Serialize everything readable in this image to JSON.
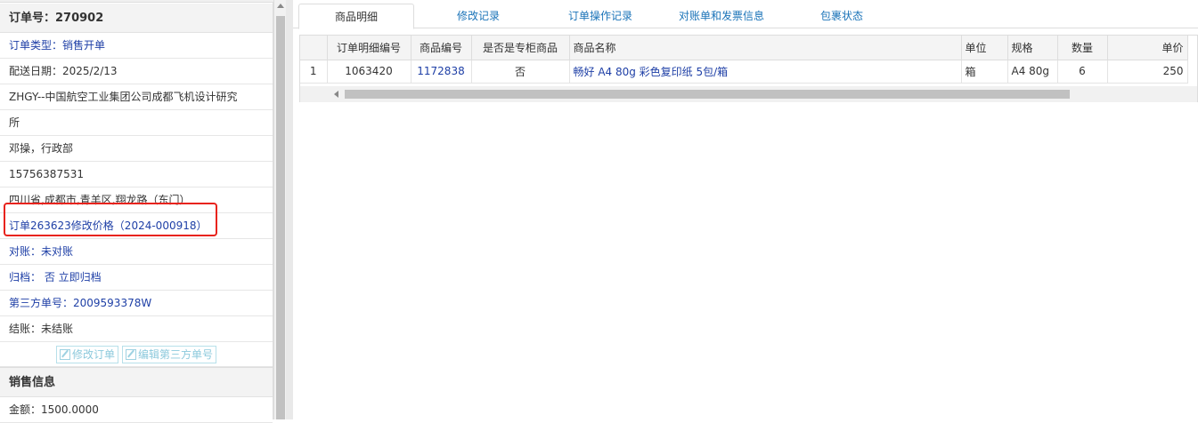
{
  "order_panel": {
    "title": "订单号：270902",
    "rows": [
      {
        "text": "订单类型：销售开单",
        "blue": true
      },
      {
        "text": "配送日期：2025/2/13",
        "blue": false
      },
      {
        "text": "ZHGY--中国航空工业集团公司成都飞机设计研究",
        "blue": false
      },
      {
        "text": "所",
        "blue": false
      },
      {
        "text": "邓操，行政部",
        "blue": false
      },
      {
        "text": "15756387531",
        "blue": false
      },
      {
        "text": "四川省,成都市,青羊区,翔龙路（东门）",
        "blue": false
      },
      {
        "text": "订单263623修改价格（2024-000918）",
        "blue": true
      },
      {
        "text": "对账：未对账",
        "blue": true
      },
      {
        "text": "归档：  否 立即归档",
        "blue": true
      },
      {
        "text": "第三方单号：2009593378W",
        "blue": true
      },
      {
        "text": "结账：未结账",
        "blue": false
      }
    ],
    "buttons": {
      "edit_order": "修改订单",
      "edit_third_party": "编辑第三方单号"
    }
  },
  "sales_panel": {
    "title": "销售信息",
    "amount": "金额：1500.0000"
  },
  "tabs": [
    "商品明细",
    "修改记录",
    "订单操作记录",
    "对账单和发票信息",
    "包裹状态"
  ],
  "table": {
    "headers": [
      "",
      "订单明细编号",
      "商品编号",
      "是否是专柜商品",
      "商品名称",
      "单位",
      "规格",
      "数量",
      "单价"
    ],
    "rows": [
      [
        "1",
        "1063420",
        "1172838",
        "否",
        "畅好 A4 80g 彩色复印纸 5包/箱",
        "箱",
        "A4 80g",
        "6",
        "250"
      ]
    ]
  },
  "colors": {
    "link": "#1e3fa6",
    "tab_link": "#1a73b8",
    "highlight": "#e8231c"
  }
}
